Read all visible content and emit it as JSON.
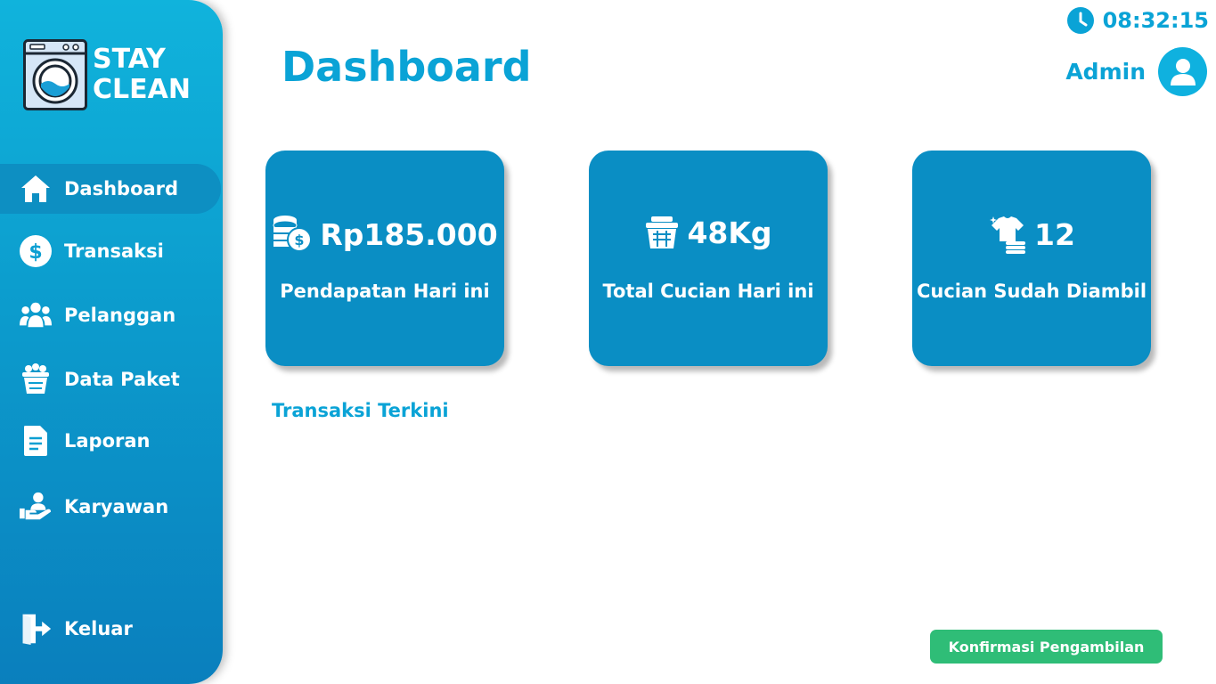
{
  "app": {
    "logo_line1": "STAY",
    "logo_line2": "CLEAN"
  },
  "sidebar": {
    "items": [
      {
        "label": "Dashboard",
        "icon": "home-icon",
        "active": true
      },
      {
        "label": "Transaksi",
        "icon": "dollar-icon"
      },
      {
        "label": "Pelanggan",
        "icon": "users-icon"
      },
      {
        "label": "Data Paket",
        "icon": "laundry-basket-icon"
      },
      {
        "label": "Laporan",
        "icon": "document-icon"
      },
      {
        "label": "Karyawan",
        "icon": "employee-hand-icon"
      }
    ],
    "logout_label": "Keluar"
  },
  "header": {
    "title": "Dashboard",
    "time": "08:32:15",
    "user": "Admin"
  },
  "cards": [
    {
      "value": "Rp185.000",
      "label": "Pendapatan Hari ini",
      "icon": "coins-icon"
    },
    {
      "value": "48Kg",
      "label": "Total Cucian Hari ini",
      "icon": "laundry-basket-icon"
    },
    {
      "value": "12",
      "label": "Cucian Sudah Diambil",
      "icon": "clean-shirt-icon"
    }
  ],
  "recent": {
    "title": "Transaksi Terkini"
  },
  "actions": {
    "confirm_label": "Konfirmasi Pengambilan"
  },
  "colors": {
    "primary": "#0aa3d6",
    "card": "#0a8ec4",
    "confirm": "#2fbd77"
  }
}
